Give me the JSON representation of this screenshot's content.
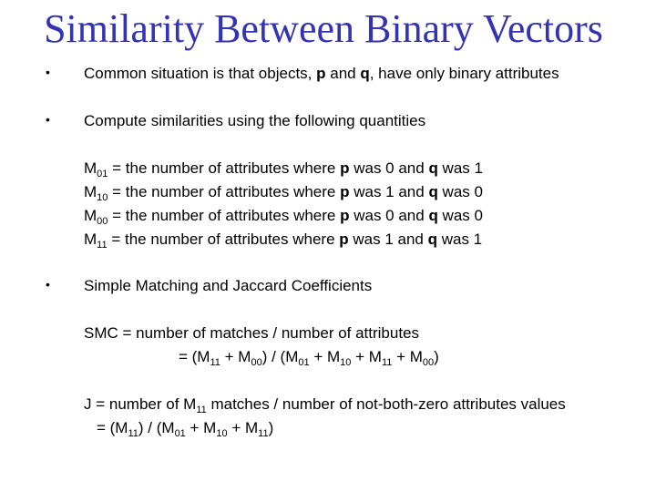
{
  "slide": {
    "title": "Similarity Between Binary Vectors",
    "title_color": "#3333b3",
    "bullets": [
      {
        "pre": "Common situation is that objects, ",
        "p": "p",
        "mid": " and ",
        "q": "q",
        "post": ", have only binary attributes"
      },
      {
        "text": "Compute similarities using the following quantities"
      },
      {
        "text": "Simple Matching and Jaccard Coefficients"
      }
    ],
    "bullet_glyph": "•",
    "quantities": [
      {
        "sym": "M",
        "sub": "01",
        "pre": " = the number of attributes where ",
        "p": "p",
        "mid1": " was 0 and ",
        "q": "q",
        "post": " was 1"
      },
      {
        "sym": "M",
        "sub": "10",
        "pre": " = the number of attributes where ",
        "p": "p",
        "mid1": " was 1 and ",
        "q": "q",
        "post": " was 0"
      },
      {
        "sym": "M",
        "sub": "00",
        "pre": " = the number of attributes where ",
        "p": "p",
        "mid1": " was 0 and ",
        "q": "q",
        "post": " was 0"
      },
      {
        "sym": "M",
        "sub": "11",
        "pre": " = the number of attributes where ",
        "p": "p",
        "mid1": " was 1 and ",
        "q": "q",
        "post": " was 1"
      }
    ],
    "smc": {
      "line1": "SMC =  number of matches / number of attributes",
      "line2": {
        "t0": "=  (M",
        "s0": "11",
        "t1": " + M",
        "s1": "00",
        "t2": ") / (M",
        "s2": "01",
        "t3": " + M",
        "s3": "10",
        "t4": " + M",
        "s4": "11",
        "t5": " + M",
        "s5": "00",
        "t6": ")"
      }
    },
    "jaccard": {
      "line1": {
        "t0": "J = number of M",
        "s0": "11",
        "t1": " matches / number of not-both-zero attributes values"
      },
      "line2": {
        "t0": "= (M",
        "s0": "11",
        "t1": ") / (M",
        "s1": "01",
        "t2": " + M",
        "s2": "10",
        "t3": " + M",
        "s3": "11",
        "t4": ")"
      }
    }
  }
}
